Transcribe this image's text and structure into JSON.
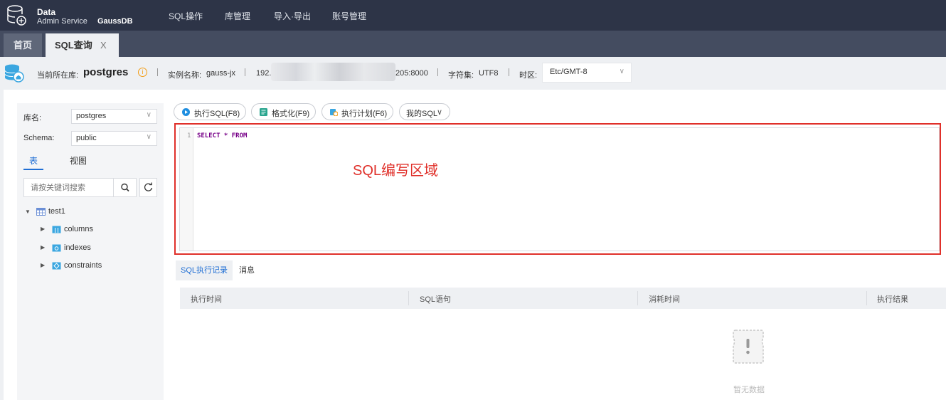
{
  "app": {
    "brand_line1": "Data",
    "brand_line2": "Admin Service",
    "brand_line3": "GaussDB",
    "menu": [
      "SQL操作",
      "库管理",
      "导入·导出",
      "账号管理"
    ]
  },
  "tabs": {
    "home": "首页",
    "sql": "SQL查询",
    "close": "X"
  },
  "info": {
    "current_db_label": "当前所在库:",
    "current_db": "postgres",
    "instance_label": "实例名称:",
    "instance": "gauss-jx",
    "ip_prefix": "192.",
    "ip_suffix": "205:8000",
    "charset_label": "字符集:",
    "charset": "UTF8",
    "timezone_label": "时区:",
    "timezone": "Etc/GMT-8"
  },
  "sidebar": {
    "db_label": "库名:",
    "db_value": "postgres",
    "schema_label": "Schema:",
    "schema_value": "public",
    "tab_table": "表",
    "tab_view": "视图",
    "search_placeholder": "请按关键词搜索",
    "tree": {
      "table": "test1",
      "children": [
        "columns",
        "indexes",
        "constraints"
      ]
    }
  },
  "toolbar": {
    "execute": "执行SQL(F8)",
    "format": "格式化(F9)",
    "plan": "执行计划(F6)",
    "my_sql": "我的SQL"
  },
  "editor": {
    "line_number": "1",
    "code": "SELECT * FROM",
    "annotation": "SQL编写区域"
  },
  "bottom": {
    "tab_history": "SQL执行记录",
    "tab_message": "消息",
    "columns": [
      "执行时间",
      "SQL语句",
      "消耗时间",
      "执行结果"
    ],
    "empty_text": "暂无数据"
  },
  "colors": {
    "nav_bg": "#2d3447",
    "accent": "#1f6ed4",
    "annotation_red": "#e0302a"
  }
}
